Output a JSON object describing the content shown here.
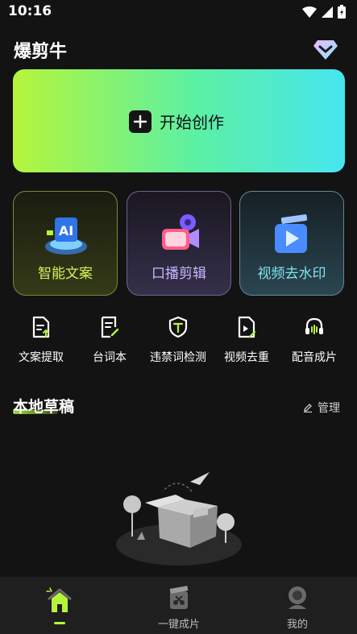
{
  "status_bar": {
    "time": "10:16"
  },
  "header": {
    "app_title": "爆剪牛"
  },
  "hero": {
    "label": "开始创作"
  },
  "feature_cards": [
    {
      "label": "智能文案"
    },
    {
      "label": "口播剪辑"
    },
    {
      "label": "视频去水印"
    }
  ],
  "tools": [
    {
      "label": "文案提取",
      "icon": "document-extract-icon"
    },
    {
      "label": "台词本",
      "icon": "script-edit-icon"
    },
    {
      "label": "违禁词检测",
      "icon": "shield-t-icon"
    },
    {
      "label": "视频去重",
      "icon": "video-dedupe-icon"
    },
    {
      "label": "配音成片",
      "icon": "headphones-icon"
    }
  ],
  "drafts": {
    "title": "本地草稿",
    "manage_label": "管理"
  },
  "bottom_nav": [
    {
      "label": "",
      "icon": "home-icon"
    },
    {
      "label": "一键成片",
      "icon": "film-clapper-icon"
    },
    {
      "label": "我的",
      "icon": "avatar-icon"
    }
  ],
  "colors": {
    "accent_green": "#b5f53a",
    "accent_cyan": "#46e6f0",
    "background": "#131313"
  }
}
